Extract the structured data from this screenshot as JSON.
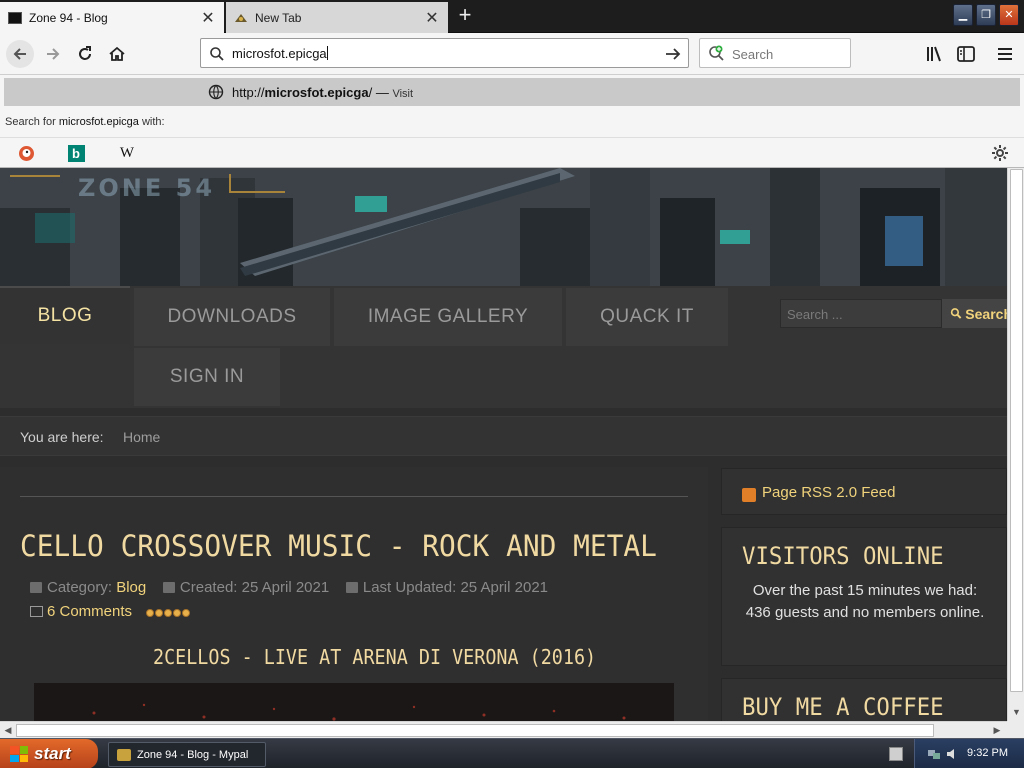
{
  "browser": {
    "tabs": [
      {
        "title": "Zone 94 - Blog",
        "active": true,
        "favicon": "zone94-favicon"
      },
      {
        "title": "New Tab",
        "active": false,
        "favicon": "newtab-favicon"
      }
    ],
    "url_value": "microsfot.epicga",
    "search_placeholder": "Search",
    "suggestion": {
      "prefix": "http://",
      "host": "microsfot.epicga",
      "suffix": "/",
      "dash": "—",
      "action": "Visit"
    },
    "search_with_prefix": "Search for ",
    "search_with_query": "microsfot.epicga",
    "search_with_suffix": " with:",
    "engines": [
      "duckduckgo-icon",
      "bing-icon",
      "wikipedia-icon"
    ],
    "wiki_glyph": "W",
    "bing_glyph": "b"
  },
  "site": {
    "logo_text": "ZONE 54",
    "menu": [
      "BLOG",
      "DOWNLOADS",
      "IMAGE GALLERY",
      "QUACK IT",
      "SIGN IN"
    ],
    "search_placeholder": "Search ...",
    "search_button": "Search",
    "breadcrumb_label": "You are here:",
    "breadcrumb_home": "Home",
    "article": {
      "title": "CELLO CROSSOVER MUSIC - ROCK AND METAL",
      "category_label": "Category:",
      "category": "Blog",
      "created": "Created: 25 April 2021",
      "updated": "Last Updated: 25 April 2021",
      "comments": "6 Comments",
      "rating": 5,
      "subtitle": "2CELLOS - LIVE AT ARENA DI VERONA (2016)"
    },
    "sidebar": {
      "rss": "Page RSS 2.0 Feed",
      "visitors_title": "VISITORS ONLINE",
      "visitors_text": "Over the past 15 minutes we had: 436 guests and no members online.",
      "coffee_title": "BUY ME A COFFEE"
    }
  },
  "taskbar": {
    "start": "start",
    "item": "Zone 94 - Blog - Mypal",
    "clock": "9:32 PM"
  },
  "colors": {
    "accent": "#f1d37c",
    "heading": "#f1d9a2",
    "page_bg": "#2d2d2d"
  }
}
